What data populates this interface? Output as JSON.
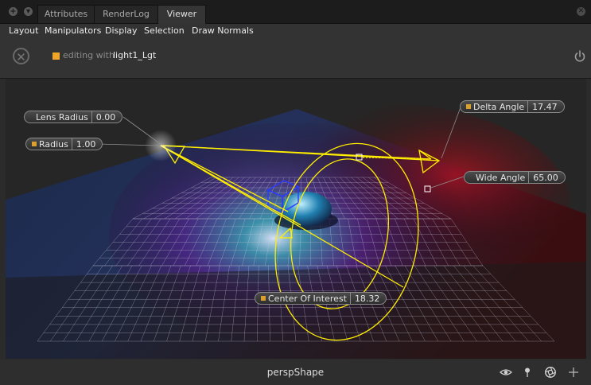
{
  "tabs": [
    {
      "label": "Attributes",
      "active": false
    },
    {
      "label": "RenderLog",
      "active": false
    },
    {
      "label": "Viewer",
      "active": true
    }
  ],
  "menu": [
    "Layout",
    "Manipulators",
    "Display",
    "Selection",
    "Draw Normals"
  ],
  "toolbar": {
    "editing_label": "editing with",
    "editing_target": "light1_Lgt"
  },
  "manipulators": {
    "lens_radius": {
      "label": "Lens Radius",
      "value": "0.00"
    },
    "radius": {
      "label": "Radius",
      "value": "1.00"
    },
    "delta_angle": {
      "label": "Delta Angle",
      "value": "17.47"
    },
    "wide_angle": {
      "label": "Wide Angle",
      "value": "65.00"
    },
    "center_of_interest": {
      "label": "Center Of Interest",
      "value": "18.32"
    }
  },
  "status": {
    "camera": "perspShape"
  },
  "icons": {
    "cancel": "circle-x-icon",
    "power": "power-icon",
    "eye": "eye-icon",
    "pin": "pin-icon",
    "aperture": "aperture-icon",
    "move": "move-icon"
  },
  "colors": {
    "accent": "#f0a428",
    "manipulator": "#ffee00"
  }
}
